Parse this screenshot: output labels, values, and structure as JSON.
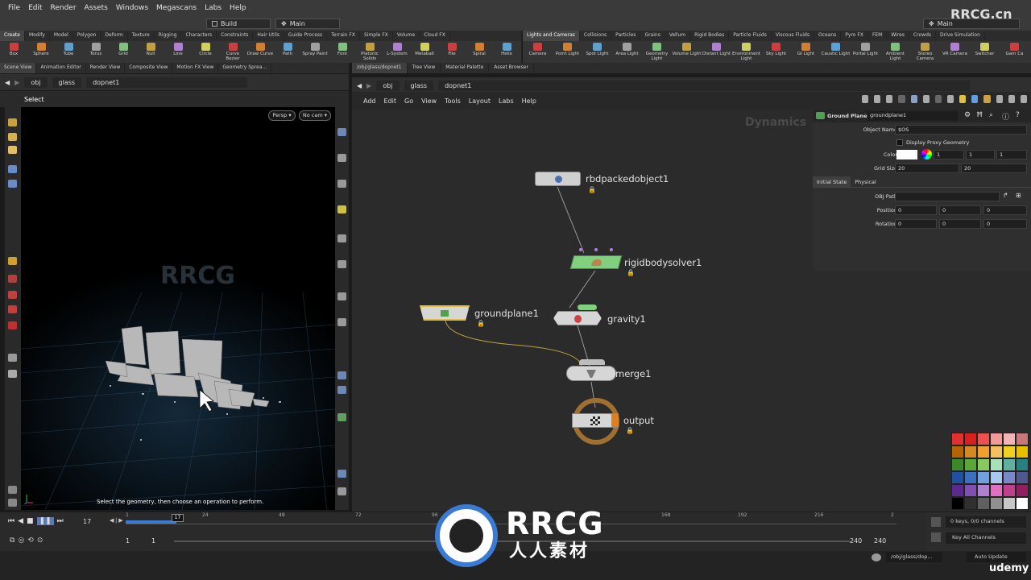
{
  "menubar": {
    "items": [
      "File",
      "Edit",
      "Render",
      "Assets",
      "Windows",
      "Megascans",
      "Labs",
      "Help"
    ],
    "desktop": "Build",
    "desktop2": "Main",
    "right_desktop": "Main"
  },
  "shelf_left": {
    "tabs": [
      "Create",
      "Modify",
      "Model",
      "Polygon",
      "Deform",
      "Texture",
      "Rigging",
      "Characters",
      "Constraints",
      "Hair Utils",
      "Guide Process",
      "Terrain FX",
      "Simple FX",
      "Volume",
      "Cloud FX"
    ],
    "tools": [
      "Box",
      "Sphere",
      "Tube",
      "Torus",
      "Grid",
      "Null",
      "Line",
      "Circle",
      "Curve Bezier",
      "Draw Curve",
      "Path",
      "Spray Paint",
      "Font",
      "Platonic Solids",
      "L-System",
      "Metaball",
      "File",
      "Spiral",
      "Helix"
    ]
  },
  "shelf_right": {
    "tabs": [
      "Lights and Cameras",
      "Collisions",
      "Particles",
      "Grains",
      "Vellum",
      "Rigid Bodies",
      "Particle Fluids",
      "Viscous Fluids",
      "Oceans",
      "Pyro FX",
      "FEM",
      "Wires",
      "Crowds",
      "Drive Simulation"
    ],
    "tools": [
      "Camera",
      "Point Light",
      "Spot Light",
      "Area Light",
      "Geometry Light",
      "Volume Light",
      "Distant Light",
      "Environment Light",
      "Sky Light",
      "GI Light",
      "Caustic Light",
      "Portal Light",
      "Ambient Light",
      "Stereo Camera",
      "VR Camera",
      "Switcher",
      "Gam Ca"
    ]
  },
  "viewport_tabs": [
    "Scene View",
    "Animation Editor",
    "Render View",
    "Composite View",
    "Motion FX View",
    "Geometry Sprea..."
  ],
  "network_tabs": [
    "/obj/glass/dopnet1",
    "Tree View",
    "Material Palette",
    "Asset Browser"
  ],
  "path_left": {
    "obj": "obj",
    "glass": "glass",
    "dopnet": "dopnet1"
  },
  "path_right": {
    "obj": "obj",
    "glass": "glass",
    "dopnet": "dopnet1"
  },
  "viewport": {
    "header": "Select",
    "persp": "Persp",
    "cam": "No cam",
    "hint": "Select the geometry, then choose an operation to perform."
  },
  "network_menu": [
    "Add",
    "Edit",
    "Go",
    "View",
    "Tools",
    "Layout",
    "Labs",
    "Help"
  ],
  "network": {
    "context_label": "Dynamics",
    "nodes": {
      "rbd": "rbdpackedobject1",
      "solver": "rigidbodysolver1",
      "groundplane": "groundplane1",
      "gravity": "gravity1",
      "merge": "merge1",
      "output": "output"
    }
  },
  "params": {
    "type": "Ground Plane",
    "name": "groundplane1",
    "object_name_label": "Object Name",
    "object_name_value": "$OS",
    "display_proxy": "Display Proxy Geometry",
    "color_label": "Color",
    "color_values": [
      "1",
      "1",
      "1"
    ],
    "grid_size_label": "Grid Size",
    "grid_size_values": [
      "20",
      "20"
    ],
    "tab_initial": "Initial State",
    "tab_physical": "Physical",
    "obj_path_label": "OBJ Path",
    "position_label": "Position",
    "position_values": [
      "0",
      "0",
      "0"
    ],
    "rotation_label": "Rotation",
    "rotation_values": [
      "0",
      "0",
      "0"
    ]
  },
  "timeline": {
    "frame": "17",
    "current_marker": "17",
    "ticks": [
      "1",
      "24",
      "48",
      "72",
      "96",
      "120",
      "144",
      "168",
      "192",
      "216",
      "2"
    ],
    "start": "1",
    "start2": "1",
    "end": "240",
    "end2": "240",
    "keys": "0 keys, 0/0 channels",
    "key_all": "Key All Channels"
  },
  "status": {
    "path": "/obj/glass/dop...",
    "auto_update": "Auto Update"
  },
  "watermark": {
    "corner": "RRCG.cn",
    "brand": "RRCG",
    "sub": "人人素材",
    "udemy": "udemy"
  },
  "palette_colors": [
    "#e03030",
    "#d82020",
    "#ee5050",
    "#f09a9a",
    "#f2b4b4",
    "#c87878",
    "#b46400",
    "#d48a20",
    "#f0a030",
    "#f4c060",
    "#f0d020",
    "#e8c000",
    "#3a8a2a",
    "#5aa83a",
    "#88c860",
    "#a8e0b8",
    "#60b0a0",
    "#2a8080",
    "#2050a0",
    "#3a70c0",
    "#70a0e0",
    "#a8c8f0",
    "#7888c8",
    "#505890",
    "#5a2a90",
    "#8050b0",
    "#b080d0",
    "#e070c0",
    "#c04090",
    "#902060",
    "#000000",
    "#303030",
    "#606060",
    "#909090",
    "#c8c8c8",
    "#ffffff"
  ]
}
